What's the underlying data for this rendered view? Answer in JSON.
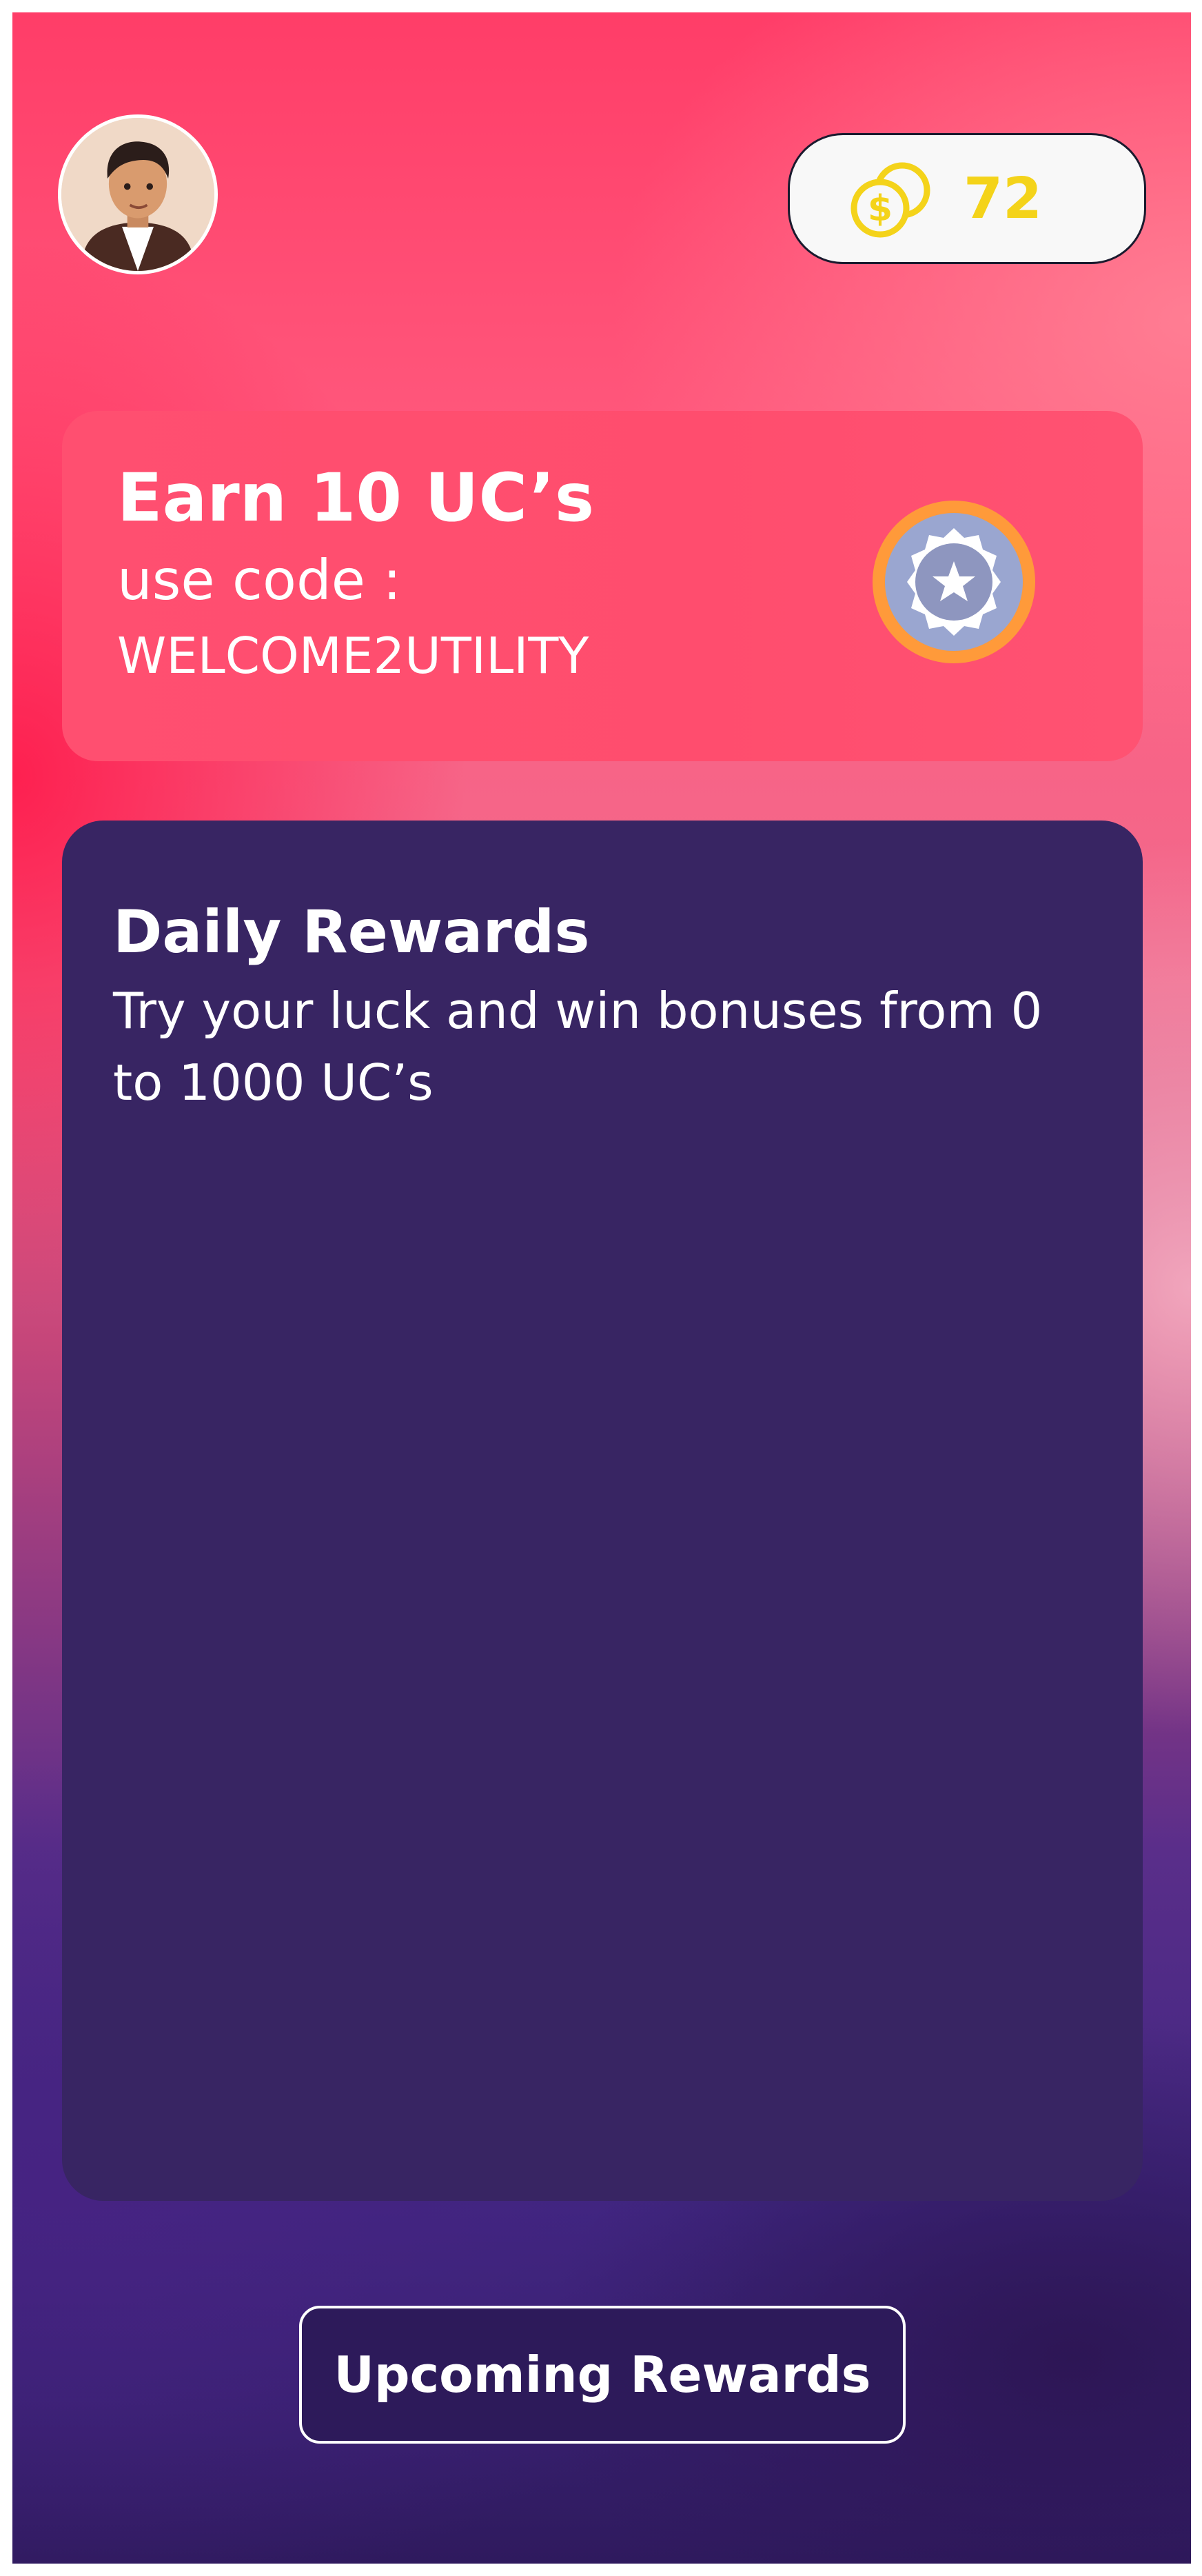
{
  "header": {
    "avatar_icon": "user-avatar-icon",
    "coins": {
      "icon": "coins-dollar-icon",
      "count": "72",
      "color": "#f4d31a"
    }
  },
  "promo": {
    "title": "Earn 10 UC’s",
    "subtitle": "use code :",
    "code": "WELCOME2UTILITY",
    "badge_icon": "star-medal-icon",
    "background": "#ff4d6e"
  },
  "daily_rewards": {
    "title": "Daily Rewards",
    "description": "Try your luck and win bonuses from 0 to 1000 UC’s",
    "background": "#382563"
  },
  "footer": {
    "upcoming_label": "Upcoming Rewards"
  }
}
